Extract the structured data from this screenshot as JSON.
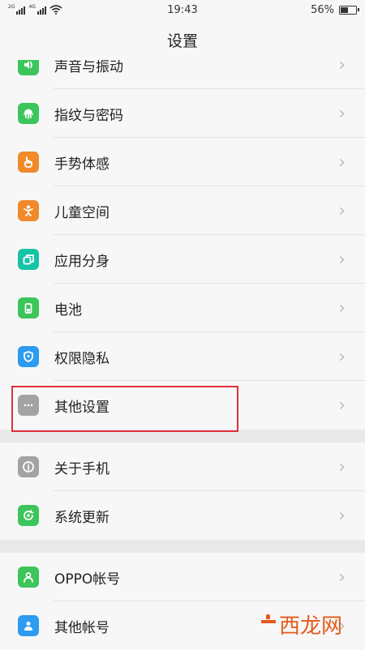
{
  "status_bar": {
    "sim1": "2G",
    "sim2": "4G",
    "time": "19:43",
    "battery_percent": "56%",
    "battery_level": 0.56
  },
  "header": {
    "title": "设置"
  },
  "colors": {
    "green": "#3cc55a",
    "orange": "#f08a2b",
    "teal": "#16c3a6",
    "blue": "#2d9cf0",
    "gray": "#a3a3a3",
    "highlight": "#e0303a"
  },
  "groups": [
    {
      "items": [
        {
          "label": "声音与振动",
          "icon": "speaker-icon",
          "color": "#3cc55a"
        },
        {
          "label": "指纹与密码",
          "icon": "fingerprint-icon",
          "color": "#3cc55a"
        },
        {
          "label": "手势体感",
          "icon": "hand-gesture-icon",
          "color": "#f08a2b"
        },
        {
          "label": "儿童空间",
          "icon": "child-icon",
          "color": "#f08a2b"
        },
        {
          "label": "应用分身",
          "icon": "app-clone-icon",
          "color": "#16c3a6"
        },
        {
          "label": "电池",
          "icon": "battery-icon",
          "color": "#3cc55a"
        },
        {
          "label": "权限隐私",
          "icon": "shield-icon",
          "color": "#2d9cf0"
        },
        {
          "label": "其他设置",
          "icon": "more-dots-icon",
          "color": "#a3a3a3"
        }
      ]
    },
    {
      "items": [
        {
          "label": "关于手机",
          "icon": "info-icon",
          "color": "#a3a3a3"
        },
        {
          "label": "系统更新",
          "icon": "update-icon",
          "color": "#3cc55a"
        }
      ]
    },
    {
      "items": [
        {
          "label": "OPPO帐号",
          "icon": "user-icon",
          "color": "#3cc55a"
        },
        {
          "label": "其他帐号",
          "icon": "account-icon",
          "color": "#2d9cf0"
        }
      ]
    }
  ],
  "watermark": {
    "text": "西龙网"
  }
}
